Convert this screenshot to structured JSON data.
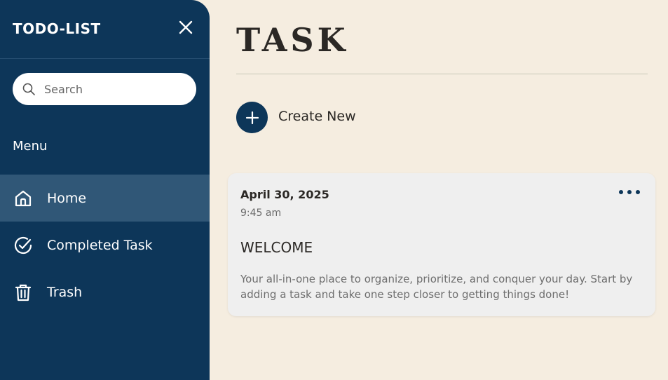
{
  "sidebar": {
    "app_title": "TODO-LIST",
    "close_icon": "close-icon",
    "search": {
      "placeholder": "Search",
      "value": "",
      "icon": "search-icon"
    },
    "menu_label": "Menu",
    "items": [
      {
        "label": "Home",
        "icon": "home-icon",
        "active": true
      },
      {
        "label": "Completed Task",
        "icon": "check-circle-icon",
        "active": false
      },
      {
        "label": "Trash",
        "icon": "trash-icon",
        "active": false
      }
    ]
  },
  "main": {
    "title": "TASK",
    "create_label": "Create New",
    "create_icon": "plus-icon",
    "tasks": [
      {
        "date": "April 30, 2025",
        "time": "9:45 am",
        "title": "WELCOME",
        "description": "Your all-in-one place to organize, prioritize, and conquer your day. Start by adding a task and take one step closer to getting things done!",
        "menu_icon": "more-horizontal-icon"
      }
    ]
  },
  "colors": {
    "sidebar_bg": "#0d3659",
    "sidebar_active": "#305777",
    "page_bg": "#f5ede0",
    "card_bg": "#efefef",
    "accent": "#0d3659"
  }
}
